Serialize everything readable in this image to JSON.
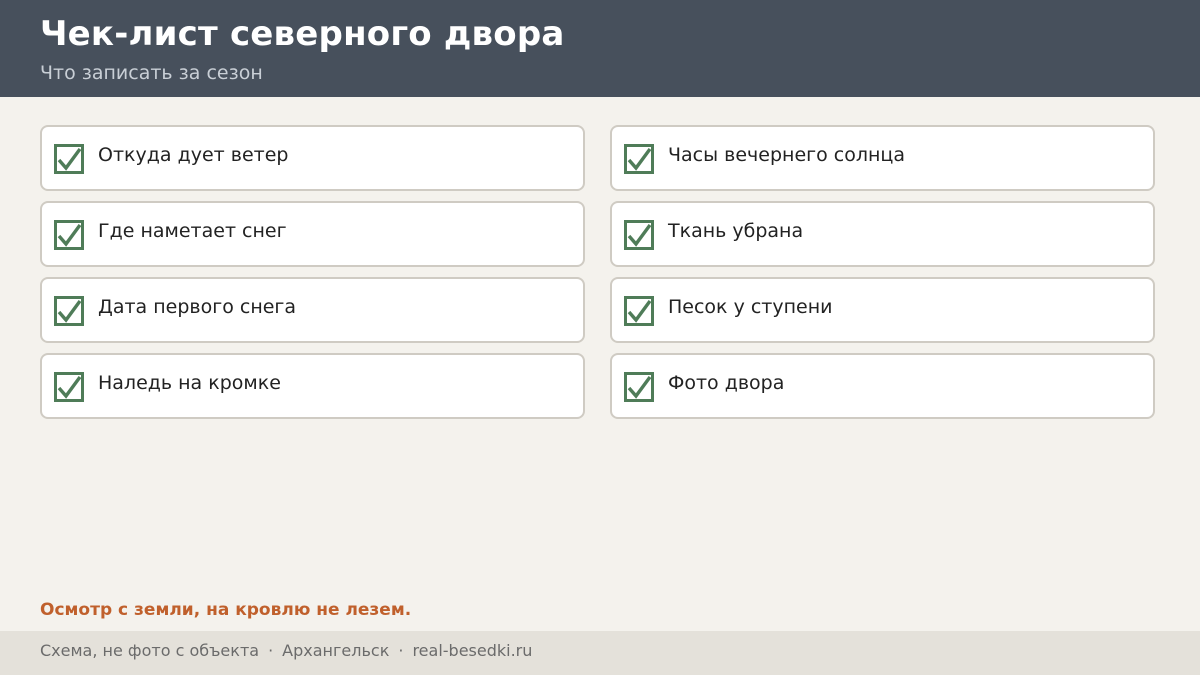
{
  "header": {
    "title": "Чек-лист северного двора",
    "subtitle": "Что записать за сезон"
  },
  "checklist": {
    "left": [
      {
        "label": "Откуда дует ветер",
        "checked": true,
        "icon": "checkmark-icon"
      },
      {
        "label": "Где наметает снег",
        "checked": true,
        "icon": "checkmark-icon"
      },
      {
        "label": "Дата первого снега",
        "checked": true,
        "icon": "checkmark-icon"
      },
      {
        "label": "Наледь на кромке",
        "checked": true,
        "icon": "checkmark-icon"
      }
    ],
    "right": [
      {
        "label": "Часы вечернего солнца",
        "checked": true,
        "icon": "checkmark-icon"
      },
      {
        "label": "Ткань убрана",
        "checked": true,
        "icon": "checkmark-icon"
      },
      {
        "label": "Песок у ступени",
        "checked": true,
        "icon": "checkmark-icon"
      },
      {
        "label": "Фото двора",
        "checked": true,
        "icon": "checkmark-icon"
      }
    ]
  },
  "note": "Осмотр с земли, на кровлю не лезем.",
  "footer": {
    "parts": [
      "Схема, не фото с объекта",
      "Архангельск",
      "real-besedki.ru"
    ],
    "separator": "·"
  },
  "colors": {
    "header_bg": "#47505c",
    "check_green": "#4f7c58",
    "note_orange": "#c0602c",
    "page_bg": "#f4f2ed",
    "footer_bg": "#e4e1da"
  }
}
